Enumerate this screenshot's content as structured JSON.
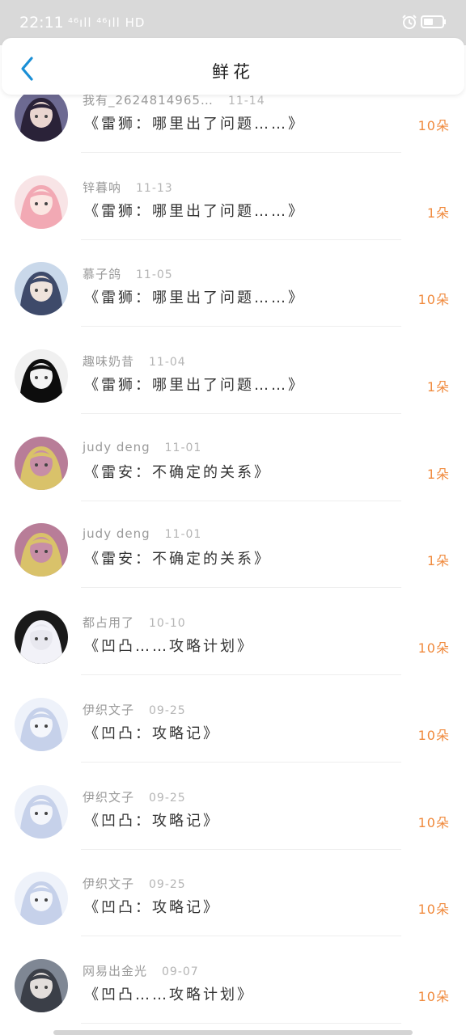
{
  "status_bar": {
    "time": "22:11",
    "network": "⁴⁶ıll ⁴⁶ıll HD",
    "colors": {
      "background": "#d9d9d9"
    }
  },
  "header": {
    "title": "鲜花",
    "back_icon": "chevron-left-icon",
    "accent": "#1a8fd6"
  },
  "colors": {
    "quantity": "#f08a3d",
    "username": "#9a9a9a",
    "text": "#333333"
  },
  "items": [
    {
      "user": "我有_2624814965…",
      "date": "11-14",
      "work": "《雷狮：哪里出了问题……》",
      "qty": "10朵",
      "avatar": {
        "bg": "#6d6a92",
        "skin": "#e9d5cf",
        "hair": "#2a2238"
      }
    },
    {
      "user": "锌暮呐",
      "date": "11-13",
      "work": "《雷狮：哪里出了问题……》",
      "qty": "1朵",
      "avatar": {
        "bg": "#f8e4e6",
        "skin": "#fbe6e2",
        "hair": "#f2a9b4"
      }
    },
    {
      "user": "慕子鸽",
      "date": "11-05",
      "work": "《雷狮：哪里出了问题……》",
      "qty": "10朵",
      "avatar": {
        "bg": "#c9d8ea",
        "skin": "#efe3dc",
        "hair": "#3e4a6a"
      }
    },
    {
      "user": "趣味奶昔",
      "date": "11-04",
      "work": "《雷狮：哪里出了问题……》",
      "qty": "1朵",
      "avatar": {
        "bg": "#f0f0f0",
        "skin": "#f4f4f4",
        "hair": "#0d0d0d"
      }
    },
    {
      "user": "judy deng",
      "date": "11-01",
      "work": "《雷安：不确定的关系》",
      "qty": "1朵",
      "avatar": {
        "bg": "#b87d98",
        "skin": "#c78ea6",
        "hair": "#d9c26a"
      }
    },
    {
      "user": "judy deng",
      "date": "11-01",
      "work": "《雷安：不确定的关系》",
      "qty": "1朵",
      "avatar": {
        "bg": "#b87d98",
        "skin": "#c78ea6",
        "hair": "#d9c26a"
      }
    },
    {
      "user": "都占用了",
      "date": "10-10",
      "work": "《凹凸……攻略计划》",
      "qty": "10朵",
      "avatar": {
        "bg": "#1a1a1a",
        "skin": "#e8e8ef",
        "hair": "#f2f2f8"
      }
    },
    {
      "user": "伊织文子",
      "date": "09-25",
      "work": "《凹凸：攻略记》",
      "qty": "10朵",
      "avatar": {
        "bg": "#eef2fa",
        "skin": "#f4f6fb",
        "hair": "#c6d1ea"
      }
    },
    {
      "user": "伊织文子",
      "date": "09-25",
      "work": "《凹凸：攻略记》",
      "qty": "10朵",
      "avatar": {
        "bg": "#eef2fa",
        "skin": "#f4f6fb",
        "hair": "#c6d1ea"
      }
    },
    {
      "user": "伊织文子",
      "date": "09-25",
      "work": "《凹凸：攻略记》",
      "qty": "10朵",
      "avatar": {
        "bg": "#eef2fa",
        "skin": "#f4f6fb",
        "hair": "#c6d1ea"
      }
    },
    {
      "user": "网易出金光",
      "date": "09-07",
      "work": "《凹凸……攻略计划》",
      "qty": "10朵",
      "avatar": {
        "bg": "#7f8794",
        "skin": "#e3dedb",
        "hair": "#3b3f48"
      }
    }
  ]
}
